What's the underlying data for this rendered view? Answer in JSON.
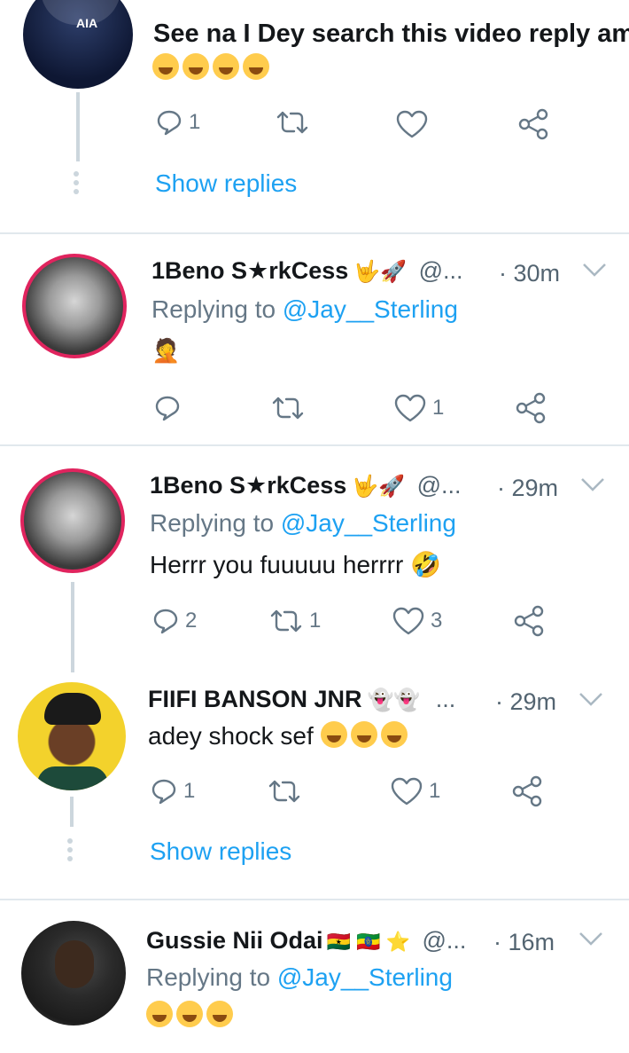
{
  "tweets": [
    {
      "text": "See na I Dey search this video reply am",
      "emoji": "😂😂😂😂",
      "replies": "1",
      "retweets": "",
      "likes": "",
      "show_replies": "Show replies"
    },
    {
      "name": "1Beno S★rkCess",
      "emoji_after_name": "🤟🚀",
      "handle": "@...",
      "time": "· 30m",
      "replying_prefix": "Replying to",
      "replying_to": "@Jay__Sterling",
      "text": "",
      "emoji": "🤦",
      "replies": "",
      "retweets": "",
      "likes": "1"
    },
    {
      "name": "1Beno S★rkCess",
      "emoji_after_name": "🤟🚀",
      "handle": "@...",
      "time": "· 29m",
      "replying_prefix": "Replying to",
      "replying_to": "@Jay__Sterling",
      "text": "Herrr you fuuuuu herrrr",
      "emoji": "🤣",
      "replies": "2",
      "retweets": "1",
      "likes": "3"
    },
    {
      "name": "FIIFI BANSON JNR",
      "emoji_after_name": "👻👻",
      "handle": "...",
      "time": "· 29m",
      "text": "adey shock sef",
      "emoji": "😂😂😂",
      "replies": "1",
      "retweets": "",
      "likes": "1",
      "show_replies": "Show replies"
    },
    {
      "name": "Gussie Nii Odai",
      "emoji_after_name": "🇬🇭 🇪🇹 ⭐",
      "handle": "@...",
      "time": "· 16m",
      "replying_prefix": "Replying to",
      "replying_to": "@Jay__Sterling",
      "text": "",
      "emoji": "😂😂😂"
    }
  ],
  "colors": {
    "link": "#1da1f2",
    "muted": "#657786",
    "separator": "#e1e8ed",
    "thread": "#ccd6dd"
  },
  "avatar_text": "AIA"
}
